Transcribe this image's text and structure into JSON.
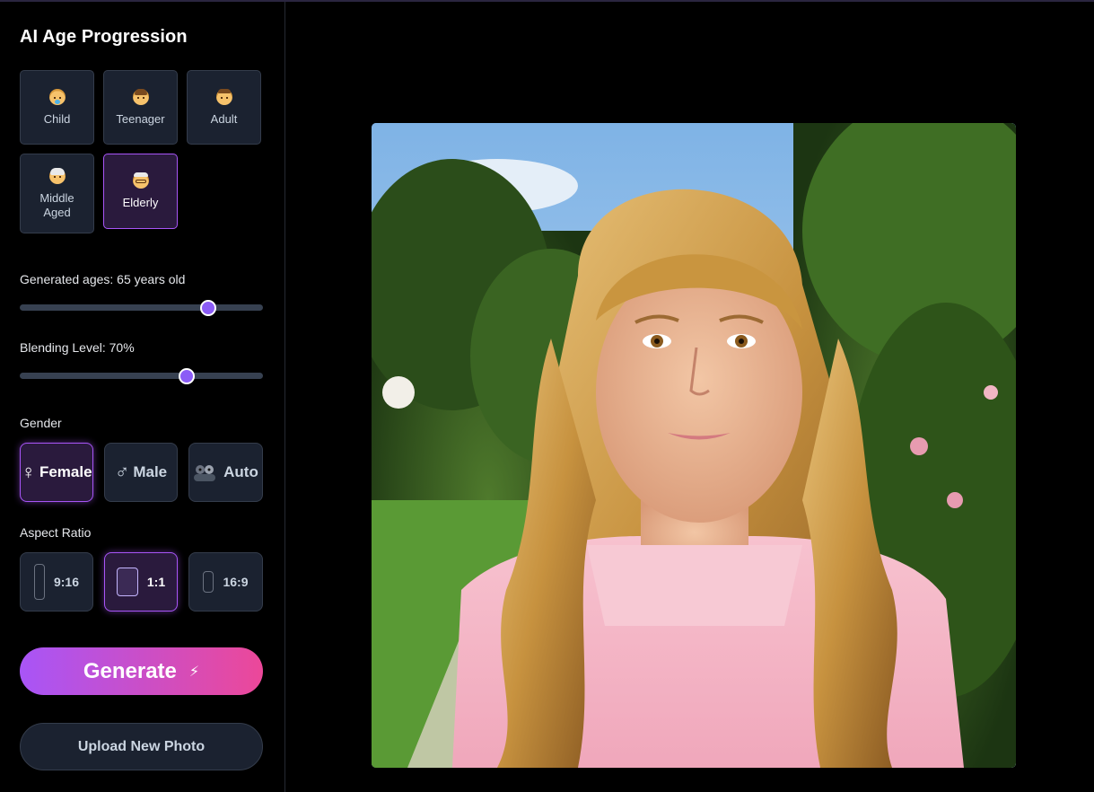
{
  "app": {
    "title": "AI Age Progression"
  },
  "age_options": [
    {
      "label": "Child",
      "icon": "baby-face-icon",
      "selected": false
    },
    {
      "label": "Teenager",
      "icon": "teen-face-icon",
      "selected": false
    },
    {
      "label": "Adult",
      "icon": "adult-face-icon",
      "selected": false
    },
    {
      "label": "Middle Aged",
      "icon": "older-face-icon",
      "selected": false
    },
    {
      "label": "Elderly",
      "icon": "elderly-face-icon",
      "selected": true
    }
  ],
  "generated_ages": {
    "label": "Generated ages: 65 years old",
    "value": 65,
    "fraction": 0.775
  },
  "blending": {
    "label": "Blending Level: 70%",
    "value": 70,
    "fraction": 0.685
  },
  "gender": {
    "label": "Gender",
    "options": [
      {
        "label": "Female",
        "symbol": "♀",
        "selected": true
      },
      {
        "label": "Male",
        "symbol": "♂",
        "selected": false
      },
      {
        "label": "Auto",
        "symbol": "people-icon",
        "selected": false
      }
    ]
  },
  "aspect_ratio": {
    "label": "Aspect Ratio",
    "options": [
      {
        "label": "9:16",
        "selected": false
      },
      {
        "label": "1:1",
        "selected": true
      },
      {
        "label": "16:9",
        "selected": false
      }
    ]
  },
  "actions": {
    "generate_label": "Generate",
    "generate_icon": "lightning-icon",
    "upload_label": "Upload New Photo"
  },
  "colors": {
    "accent": "#a855f7",
    "gradient_start": "#a855f7",
    "gradient_end": "#ec4899",
    "slider_thumb": "#8b5cf6"
  }
}
